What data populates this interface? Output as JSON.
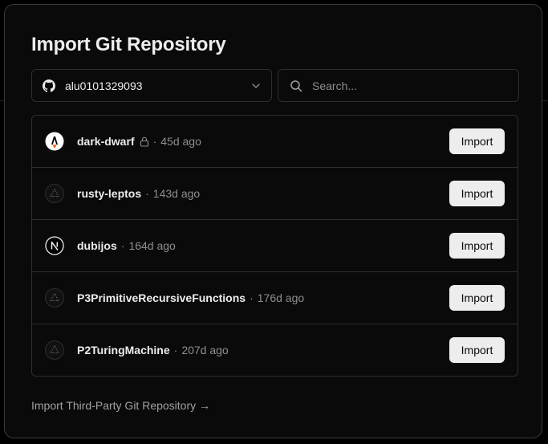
{
  "dialog": {
    "title": "Import Git Repository",
    "account_name": "alu0101329093",
    "search_placeholder": "Search...",
    "third_party_link": "Import Third-Party Git Repository →"
  },
  "repos": [
    {
      "name": "dark-dwarf",
      "private": true,
      "age": "45d ago",
      "icon": "astro-logo-icon",
      "button": "Import"
    },
    {
      "name": "rusty-leptos",
      "private": false,
      "age": "143d ago",
      "icon": "vercel-triangle-icon",
      "button": "Import"
    },
    {
      "name": "dubijos",
      "private": false,
      "age": "164d ago",
      "icon": "nextjs-logo-icon",
      "button": "Import"
    },
    {
      "name": "P3PrimitiveRecursiveFunctions",
      "private": false,
      "age": "176d ago",
      "icon": "vercel-triangle-icon",
      "button": "Import"
    },
    {
      "name": "P2TuringMachine",
      "private": false,
      "age": "207d ago",
      "icon": "vercel-triangle-icon",
      "button": "Import"
    }
  ],
  "separator": "·",
  "colors": {
    "background": "#000000",
    "card": "#0a0a0a",
    "button": "#ededed",
    "muted": "#8f8f8f",
    "accent": "#ff5d01"
  }
}
